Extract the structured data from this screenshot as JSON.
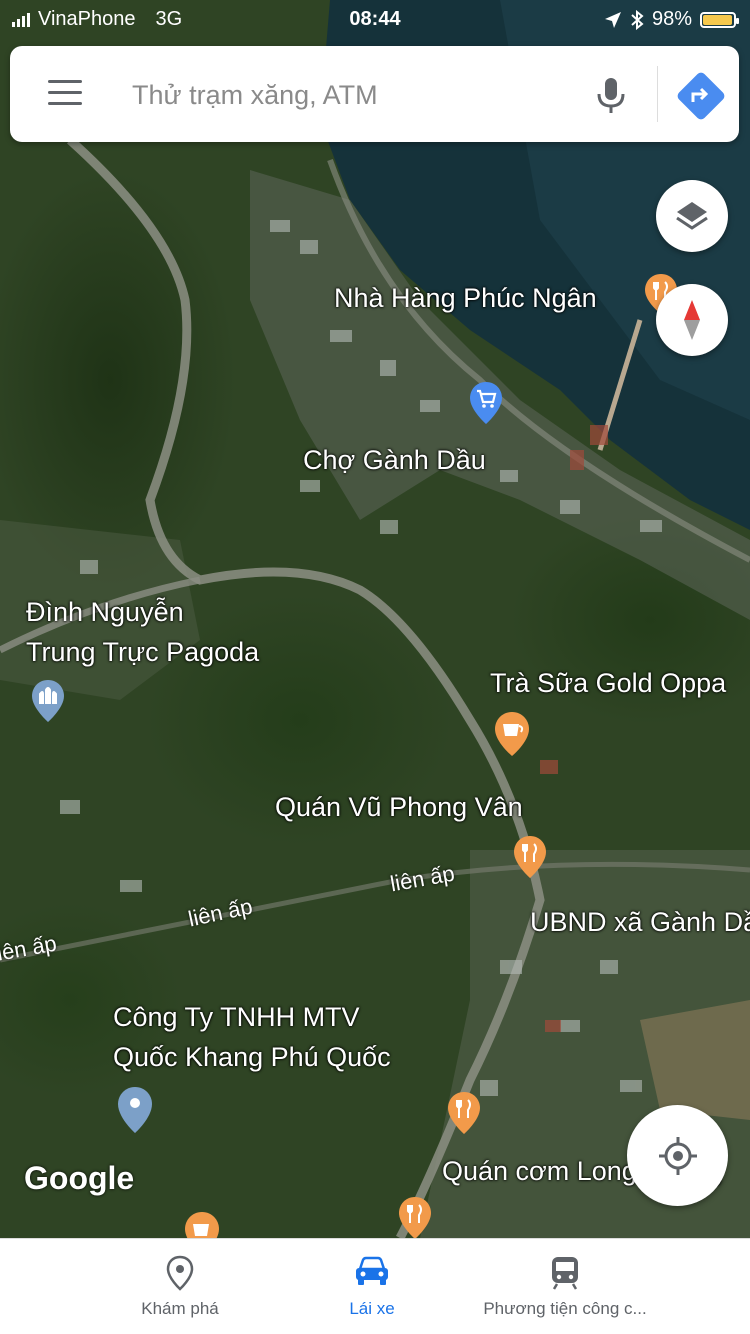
{
  "status_bar": {
    "carrier": "VinaPhone",
    "network": "3G",
    "time": "08:44",
    "battery_percent": "98%",
    "battery_level": 0.98,
    "battery_color": "#f6c84c"
  },
  "search": {
    "placeholder": "Thử trạm xăng, ATM"
  },
  "map": {
    "places": [
      {
        "name": "Nhà Hàng Phúc Ngân",
        "icon": "restaurant-icon"
      },
      {
        "name": "Chợ Gành Dầu",
        "icon": "shopping-cart-icon"
      },
      {
        "name": "Đình Nguyễn",
        "icon": "temple-icon"
      },
      {
        "name": "Trung Trực Pagoda"
      },
      {
        "name": "Trà Sữa Gold Oppa",
        "icon": "cafe-icon"
      },
      {
        "name": "Quán Vũ Phong Vân",
        "icon": "restaurant-icon"
      },
      {
        "name": "UBND xã Gành Dầu"
      },
      {
        "name": "Công Ty TNHH MTV"
      },
      {
        "name": "Quốc Khang Phú Quốc",
        "icon": "location-pin-icon"
      },
      {
        "name": "Quán cơm Long Phụng",
        "icon": "restaurant-icon"
      }
    ],
    "roads": [
      "liên ấp",
      "liên ấp",
      "liên ấp"
    ],
    "logo": "Google",
    "accent_orange": "#f29a4a",
    "accent_blue": "#4a8cf0"
  },
  "bottom_nav": [
    {
      "label": "Khám phá",
      "icon": "explore-pin-icon",
      "active": false
    },
    {
      "label": "Lái xe",
      "icon": "car-icon",
      "active": true
    },
    {
      "label": "Phương tiện công c...",
      "icon": "transit-icon",
      "active": false
    }
  ]
}
